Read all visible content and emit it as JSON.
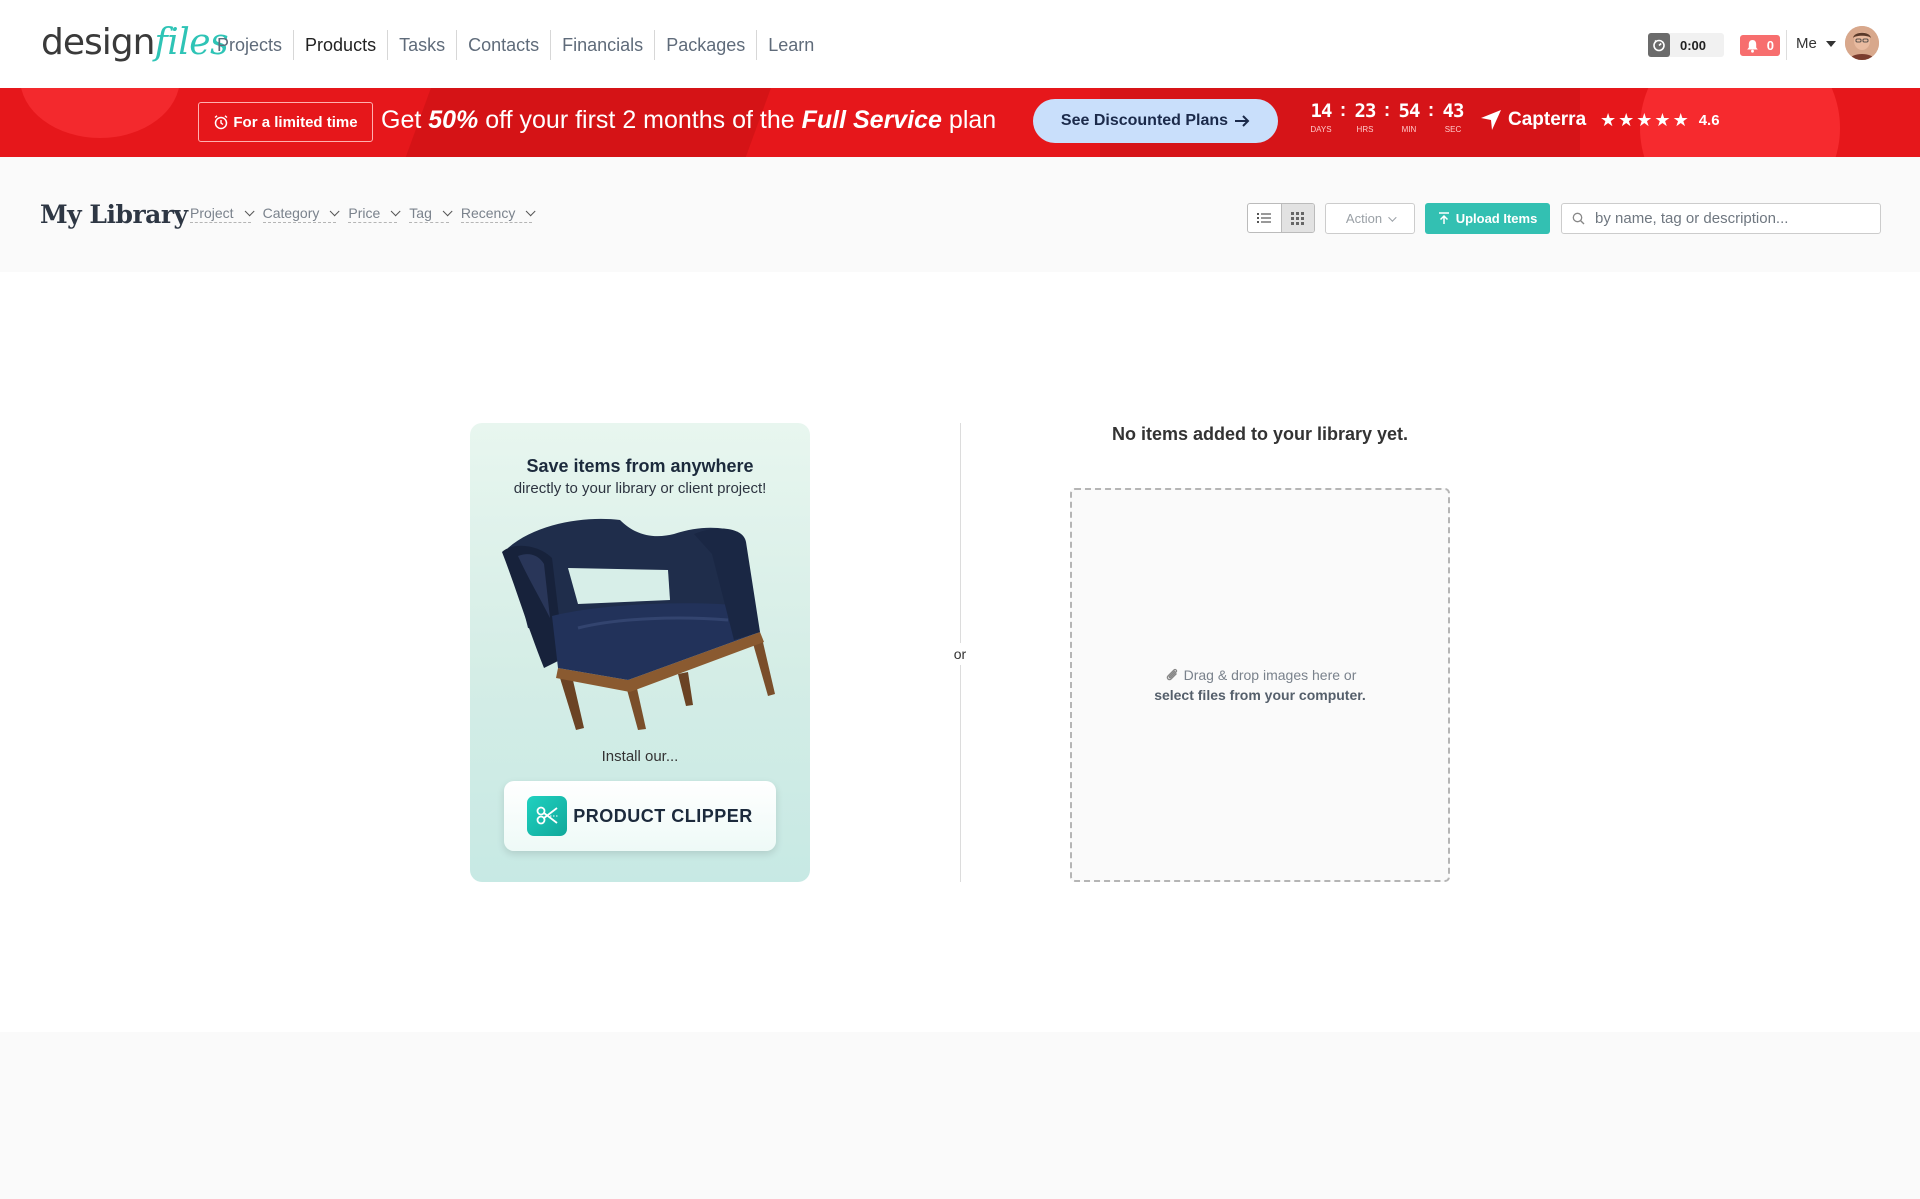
{
  "logo": {
    "design": "design",
    "files": "files"
  },
  "nav": [
    {
      "label": "Projects",
      "active": false
    },
    {
      "label": "Products",
      "active": true
    },
    {
      "label": "Tasks",
      "active": false
    },
    {
      "label": "Contacts",
      "active": false
    },
    {
      "label": "Financials",
      "active": false
    },
    {
      "label": "Packages",
      "active": false
    },
    {
      "label": "Learn",
      "active": false
    }
  ],
  "header": {
    "timer": "0:00",
    "notifications": "0",
    "user_menu": "Me"
  },
  "banner": {
    "limited": "For a limited time",
    "offer_pre": "Get ",
    "offer_pct": "50%",
    "offer_mid": " off your first 2 months of the ",
    "offer_plan": "Full Service",
    "offer_post": " plan",
    "cta": "See Discounted Plans",
    "countdown": {
      "days": "14",
      "hrs": "23",
      "min": "54",
      "sec": "43",
      "days_label": "DAYS",
      "hrs_label": "HRS",
      "min_label": "MIN",
      "sec_label": "SEC"
    },
    "review_site": "Capterra",
    "rating": "4.6",
    "stars": 5
  },
  "toolbar": {
    "title": "My Library",
    "filters": [
      "Project",
      "Category",
      "Price",
      "Tag",
      "Recency"
    ],
    "action_label": "Action",
    "upload_label": "Upload Items",
    "search_placeholder": "by name, tag or description..."
  },
  "clipper": {
    "title": "Save items from anywhere",
    "subtitle": "directly to your library or client project!",
    "install": "Install our...",
    "button": "PRODUCT CLIPPER"
  },
  "divider_label": "or",
  "empty": {
    "message": "No items added to your library yet.",
    "drop_line1": "Drag & drop images here or",
    "drop_line2": "select files from your computer."
  },
  "colors": {
    "accent": "#33c0b2",
    "banner": "#e6171b",
    "notification": "#f76e6e"
  }
}
